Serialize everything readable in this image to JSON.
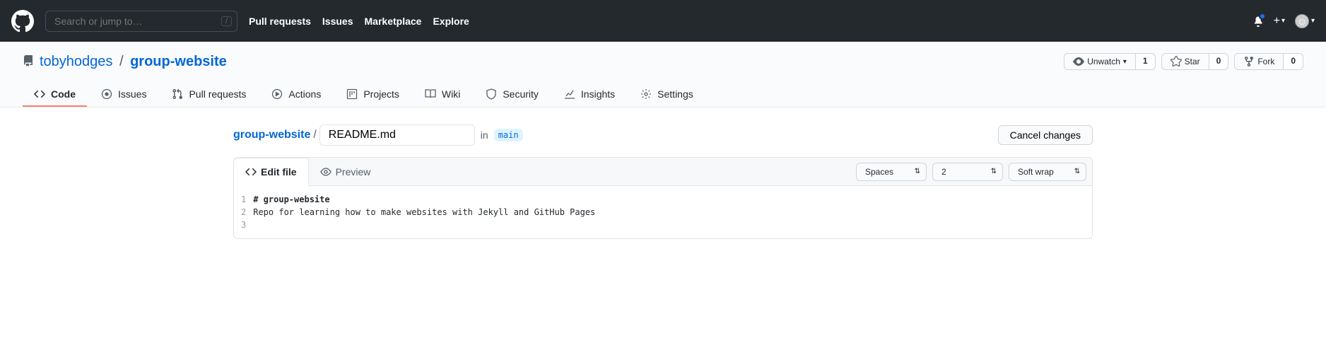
{
  "header": {
    "search_placeholder": "Search or jump to…",
    "slash": "/",
    "nav": [
      "Pull requests",
      "Issues",
      "Marketplace",
      "Explore"
    ]
  },
  "repo": {
    "owner": "tobyhodges",
    "name": "group-website",
    "watch_label": "Unwatch",
    "watch_count": "1",
    "star_label": "Star",
    "star_count": "0",
    "fork_label": "Fork",
    "fork_count": "0"
  },
  "tabs": {
    "code": "Code",
    "issues": "Issues",
    "pulls": "Pull requests",
    "actions": "Actions",
    "projects": "Projects",
    "wiki": "Wiki",
    "security": "Security",
    "insights": "Insights",
    "settings": "Settings"
  },
  "breadcrumb": {
    "root": "group-website",
    "filename": "README.md",
    "in": "in",
    "branch": "main",
    "cancel": "Cancel changes"
  },
  "editor": {
    "edit_tab": "Edit file",
    "preview_tab": "Preview",
    "indent_mode": "Spaces",
    "indent_size": "2",
    "wrap_mode": "Soft wrap",
    "lines": [
      "# group-website",
      "Repo for learning how to make websites with Jekyll and GitHub Pages",
      ""
    ],
    "line_numbers": [
      "1",
      "2",
      "3"
    ]
  }
}
